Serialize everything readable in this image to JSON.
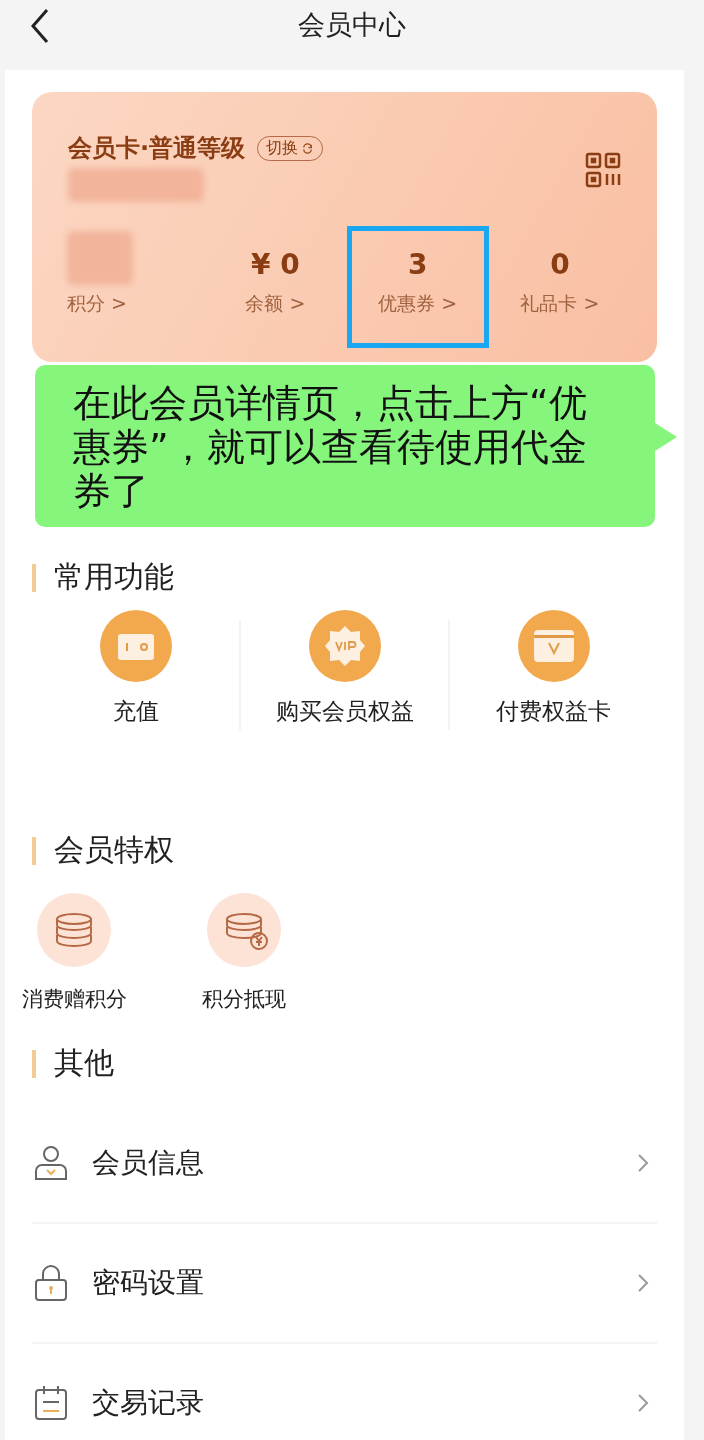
{
  "header": {
    "title": "会员中心"
  },
  "card": {
    "title": "会员卡·普通等级",
    "switch": "切换",
    "stats": [
      {
        "label": "积分 >",
        "redacted": true,
        "highlighted": false
      },
      {
        "value": "¥ 0",
        "label": "余额 >",
        "redacted": false,
        "highlighted": false
      },
      {
        "value": "3",
        "label": "优惠券 >",
        "redacted": false,
        "highlighted": true
      },
      {
        "value": "0",
        "label": "礼品卡 >",
        "redacted": false,
        "highlighted": false
      }
    ]
  },
  "callout": {
    "text": "在此会员详情页，点击上方“优惠券”，就可以查看待使用代金券了"
  },
  "sections": [
    {
      "title": "常用功能",
      "kind": "features",
      "items": [
        {
          "label": "充值"
        },
        {
          "label": "购买会员权益"
        },
        {
          "label": "付费权益卡"
        }
      ]
    },
    {
      "title": "会员特权",
      "kind": "perks",
      "items": [
        {
          "label": "消费赠积分"
        },
        {
          "label": "积分抵现"
        }
      ]
    },
    {
      "title": "其他",
      "kind": "list",
      "items": [
        {
          "label": "会员信息"
        },
        {
          "label": "密码设置"
        },
        {
          "label": "交易记录"
        }
      ]
    }
  ]
}
